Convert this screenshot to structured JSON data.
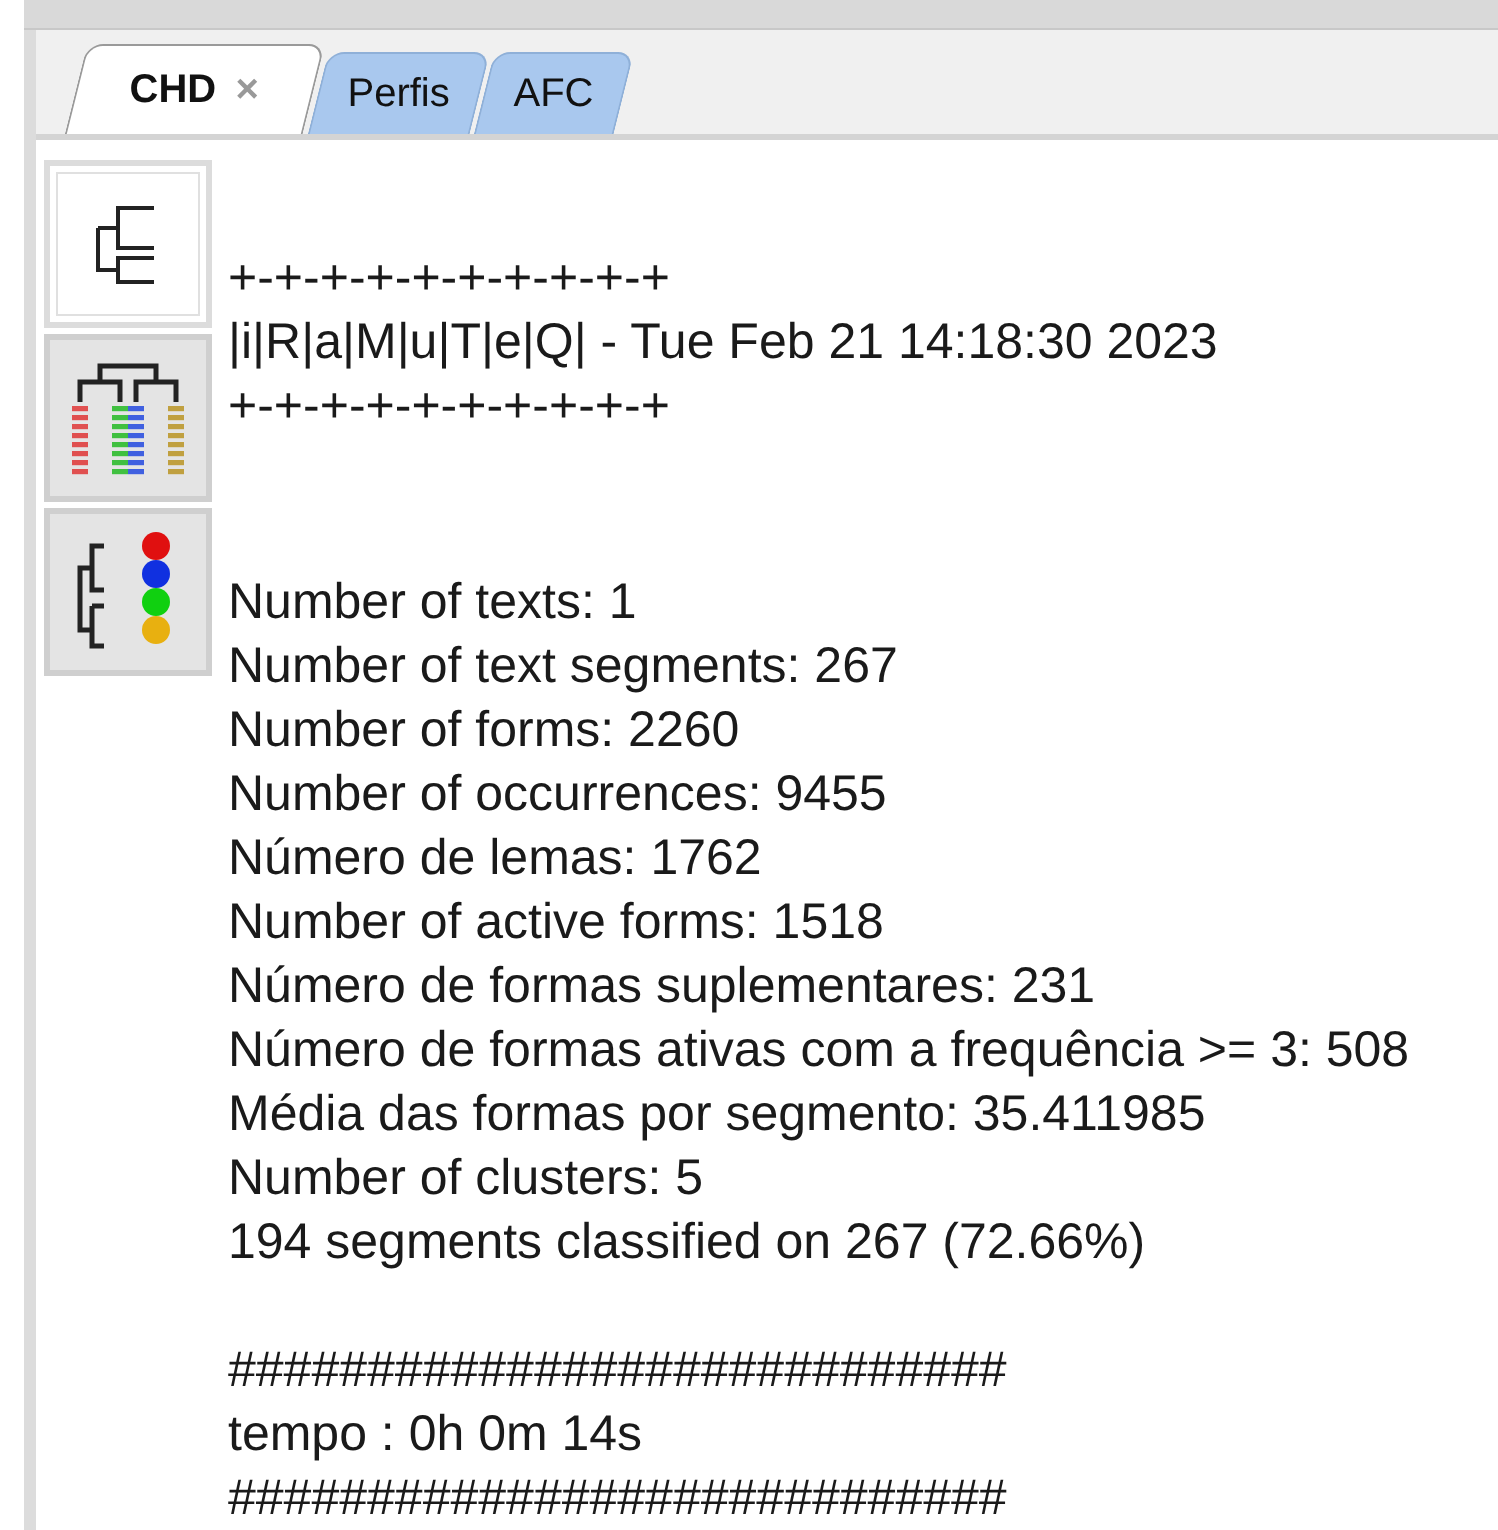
{
  "tabs": [
    {
      "label": "CHD",
      "selected": true,
      "close": "×"
    },
    {
      "label": "Perfis",
      "selected": false
    },
    {
      "label": "AFC",
      "selected": false
    }
  ],
  "tool_buttons": [
    {
      "kind": "tree",
      "selected": true
    },
    {
      "kind": "dendrogram",
      "selected": false
    },
    {
      "kind": "clusters",
      "selected": false
    }
  ],
  "output": {
    "header": [
      "+-+-+-+-+-+-+-+-+-+",
      "|i|R|a|M|u|T|e|Q| - Tue Feb 21 14:18:30 2023",
      "+-+-+-+-+-+-+-+-+-+"
    ],
    "stats": [
      "Number of texts: 1",
      "Number of text segments: 267",
      "Number of forms: 2260",
      "Number of occurrences: 9455",
      "Número de lemas: 1762",
      "Number of active forms: 1518",
      "Número de formas suplementares: 231",
      "Número de formas ativas com a frequência >= 3: 508",
      "Média das formas por segmento: 35.411985",
      "Number of clusters: 5",
      "194 segments classified on 267 (72.66%)"
    ],
    "footer": [
      "############################",
      "tempo : 0h 0m 14s",
      "############################"
    ]
  }
}
